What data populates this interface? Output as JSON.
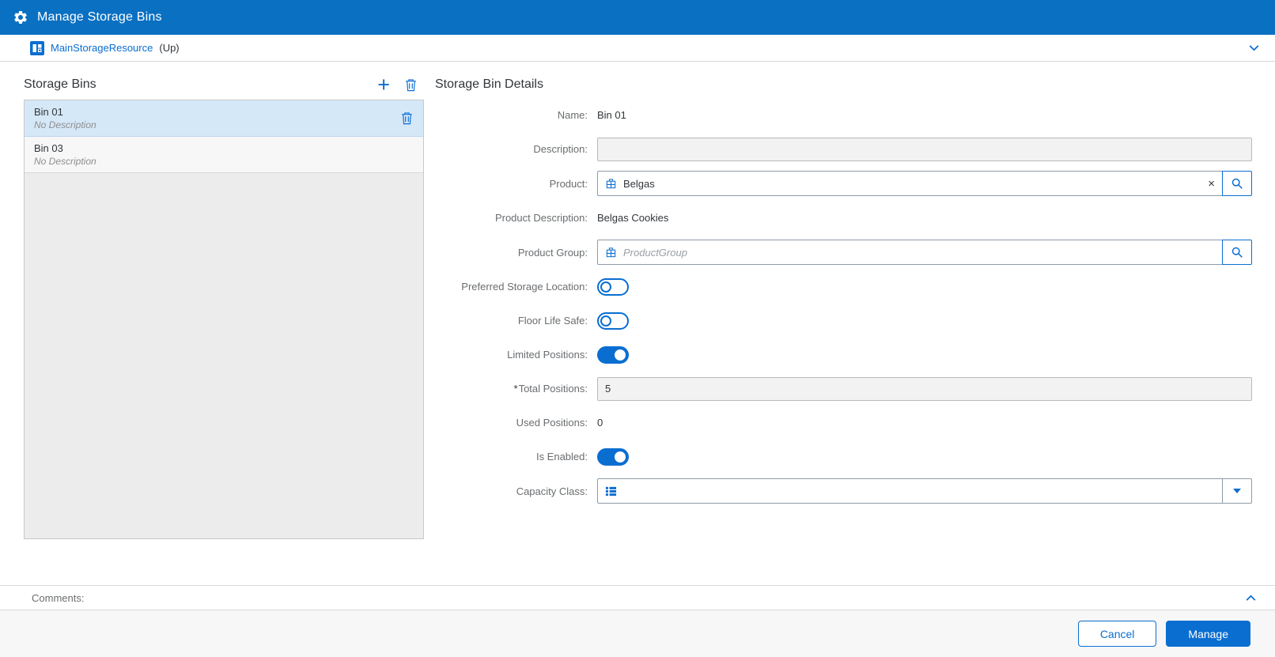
{
  "colors": {
    "header_bg": "#0a70c2",
    "accent": "#0a6ed1",
    "selected_row": "#d5e8f8"
  },
  "header": {
    "title": "Manage Storage Bins",
    "icon": "gear-icon"
  },
  "breadcrumb": {
    "resource": "MainStorageResource",
    "suffix": "(Up)",
    "collapse_icon": "chevron-down-icon"
  },
  "bins_panel": {
    "title": "Storage Bins",
    "add_icon": "+",
    "delete_icon": "trash-icon",
    "items": [
      {
        "name": "Bin 01",
        "description": "No Description",
        "selected": true
      },
      {
        "name": "Bin 03",
        "description": "No Description",
        "selected": false
      }
    ]
  },
  "details": {
    "title": "Storage Bin Details",
    "name": {
      "label": "Name:",
      "value": "Bin 01"
    },
    "description": {
      "label": "Description:",
      "value": ""
    },
    "product": {
      "label": "Product:",
      "value": "Belgas",
      "clear_icon": "×",
      "search_icon": "magnifier-icon"
    },
    "product_description": {
      "label": "Product Description:",
      "value": "Belgas Cookies"
    },
    "product_group": {
      "label": "Product Group:",
      "value": "",
      "placeholder": "ProductGroup",
      "search_icon": "magnifier-icon"
    },
    "preferred_storage_location": {
      "label": "Preferred Storage Location:",
      "on": false
    },
    "floor_life_safe": {
      "label": "Floor Life Safe:",
      "on": false
    },
    "limited_positions": {
      "label": "Limited Positions:",
      "on": true
    },
    "total_positions": {
      "label": "Total Positions:",
      "required_marker": "*",
      "value": "5"
    },
    "used_positions": {
      "label": "Used Positions:",
      "value": "0"
    },
    "is_enabled": {
      "label": "Is Enabled:",
      "on": true
    },
    "capacity_class": {
      "label": "Capacity Class:",
      "value": "",
      "list_icon": "list-icon",
      "dropdown_icon": "chevron-down-icon"
    }
  },
  "comments": {
    "label": "Comments:",
    "collapse_icon": "chevron-up-icon"
  },
  "footer": {
    "cancel_label": "Cancel",
    "manage_label": "Manage"
  }
}
